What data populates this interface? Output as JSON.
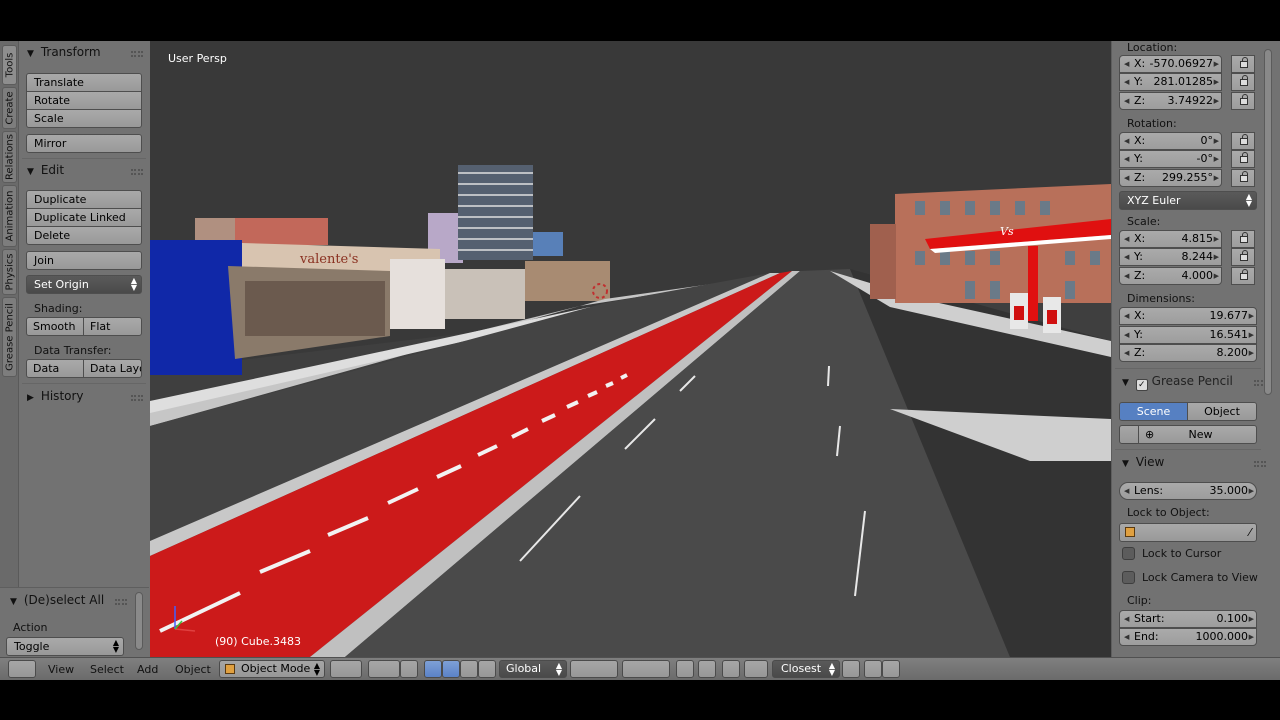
{
  "viewport": {
    "view_label": "User Persp",
    "object_info": "(90) Cube.3483",
    "scene": {
      "signs": {
        "shop": "valente's",
        "gas": "Vs"
      }
    }
  },
  "left_tabs": [
    "Tools",
    "Create",
    "Relations",
    "Animation",
    "Physics",
    "Grease Pencil"
  ],
  "toolshelf": {
    "transform": {
      "title": "Transform",
      "buttons": [
        "Translate",
        "Rotate",
        "Scale"
      ],
      "mirror": "Mirror"
    },
    "edit": {
      "title": "Edit",
      "buttons": [
        "Duplicate",
        "Duplicate Linked",
        "Delete"
      ],
      "join": "Join",
      "set_origin": "Set Origin",
      "shading_label": "Shading:",
      "shading": [
        "Smooth",
        "Flat"
      ],
      "data_transfer_label": "Data Transfer:",
      "data_transfer": [
        "Data",
        "Data Layo"
      ]
    },
    "history": {
      "title": "History"
    }
  },
  "operator": {
    "title": "(De)select All",
    "action_label": "Action",
    "action_value": "Toggle"
  },
  "properties": {
    "location": {
      "label": "Location:",
      "x": {
        "axis": "X:",
        "value": "-570.06927"
      },
      "y": {
        "axis": "Y:",
        "value": "281.01285"
      },
      "z": {
        "axis": "Z:",
        "value": "3.74922"
      }
    },
    "rotation": {
      "label": "Rotation:",
      "x": {
        "axis": "X:",
        "value": "0°"
      },
      "y": {
        "axis": "Y:",
        "value": "-0°"
      },
      "z": {
        "axis": "Z:",
        "value": "299.255°"
      },
      "mode": "XYZ Euler"
    },
    "scale": {
      "label": "Scale:",
      "x": {
        "axis": "X:",
        "value": "4.815"
      },
      "y": {
        "axis": "Y:",
        "value": "8.244"
      },
      "z": {
        "axis": "Z:",
        "value": "4.000"
      }
    },
    "dimensions": {
      "label": "Dimensions:",
      "x": {
        "axis": "X:",
        "value": "19.677"
      },
      "y": {
        "axis": "Y:",
        "value": "16.541"
      },
      "z": {
        "axis": "Z:",
        "value": "8.200"
      }
    },
    "grease_pencil": {
      "title": "Grease Pencil",
      "tabs": [
        "Scene",
        "Object"
      ],
      "new_label": "New"
    },
    "view": {
      "title": "View",
      "lens_label": "Lens:",
      "lens_value": "35.000",
      "lock_object_label": "Lock to Object:",
      "lock_cursor": "Lock to Cursor",
      "lock_camera": "Lock Camera to View",
      "clip_label": "Clip:",
      "clip_start_label": "Start:",
      "clip_start": "0.100",
      "clip_end_label": "End:",
      "clip_end": "1000.000"
    }
  },
  "header": {
    "menus": [
      "View",
      "Select",
      "Add",
      "Object"
    ],
    "mode": "Object Mode",
    "orientation": "Global",
    "snap": "Closest"
  },
  "colors": {
    "panel_bg": "#727272",
    "viewport_bg": "#393939",
    "bike_lane": "#cc1a1a",
    "selected_tab": "#5680c2"
  }
}
